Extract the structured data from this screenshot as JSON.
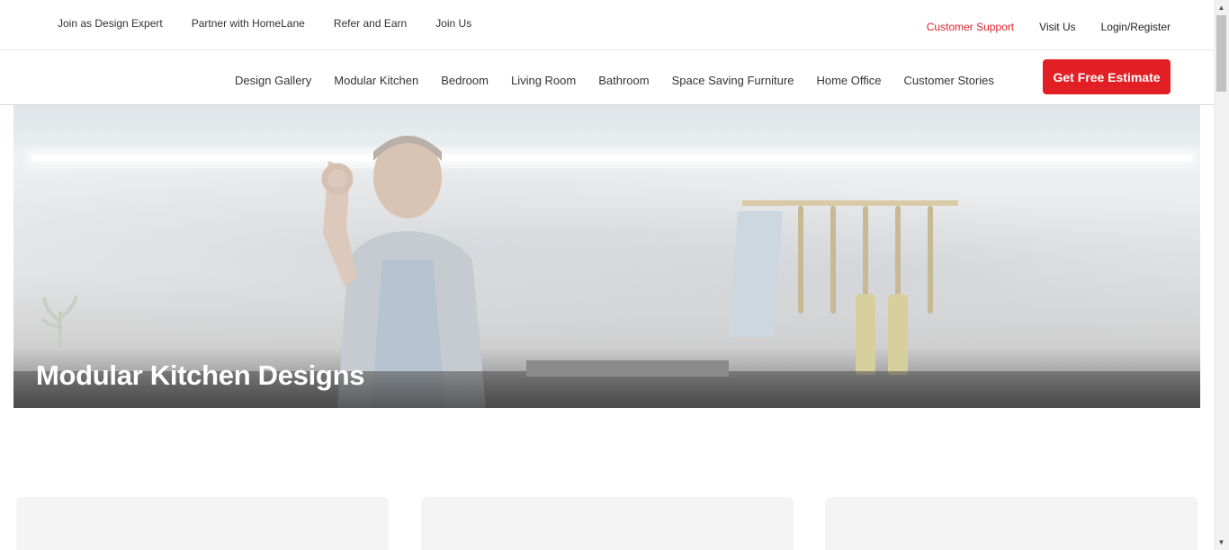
{
  "topbar": {
    "links": [
      "Join as Design Expert",
      "Partner with HomeLane",
      "Refer and Earn",
      "Join Us"
    ],
    "support": "Customer Support",
    "visit": "Visit Us",
    "login": "Login/Register"
  },
  "nav": {
    "items": [
      "Design Gallery",
      "Modular Kitchen",
      "Bedroom",
      "Living Room",
      "Bathroom",
      "Space Saving Furniture",
      "Home Office",
      "Customer Stories"
    ],
    "cta": "Get Free Estimate"
  },
  "hero": {
    "title": "Modular Kitchen Designs"
  },
  "colors": {
    "accent": "#e31f26",
    "support_link": "#e0232f"
  },
  "icons": {
    "scroll_up": "caret-up-icon",
    "scroll_down": "caret-down-icon"
  }
}
